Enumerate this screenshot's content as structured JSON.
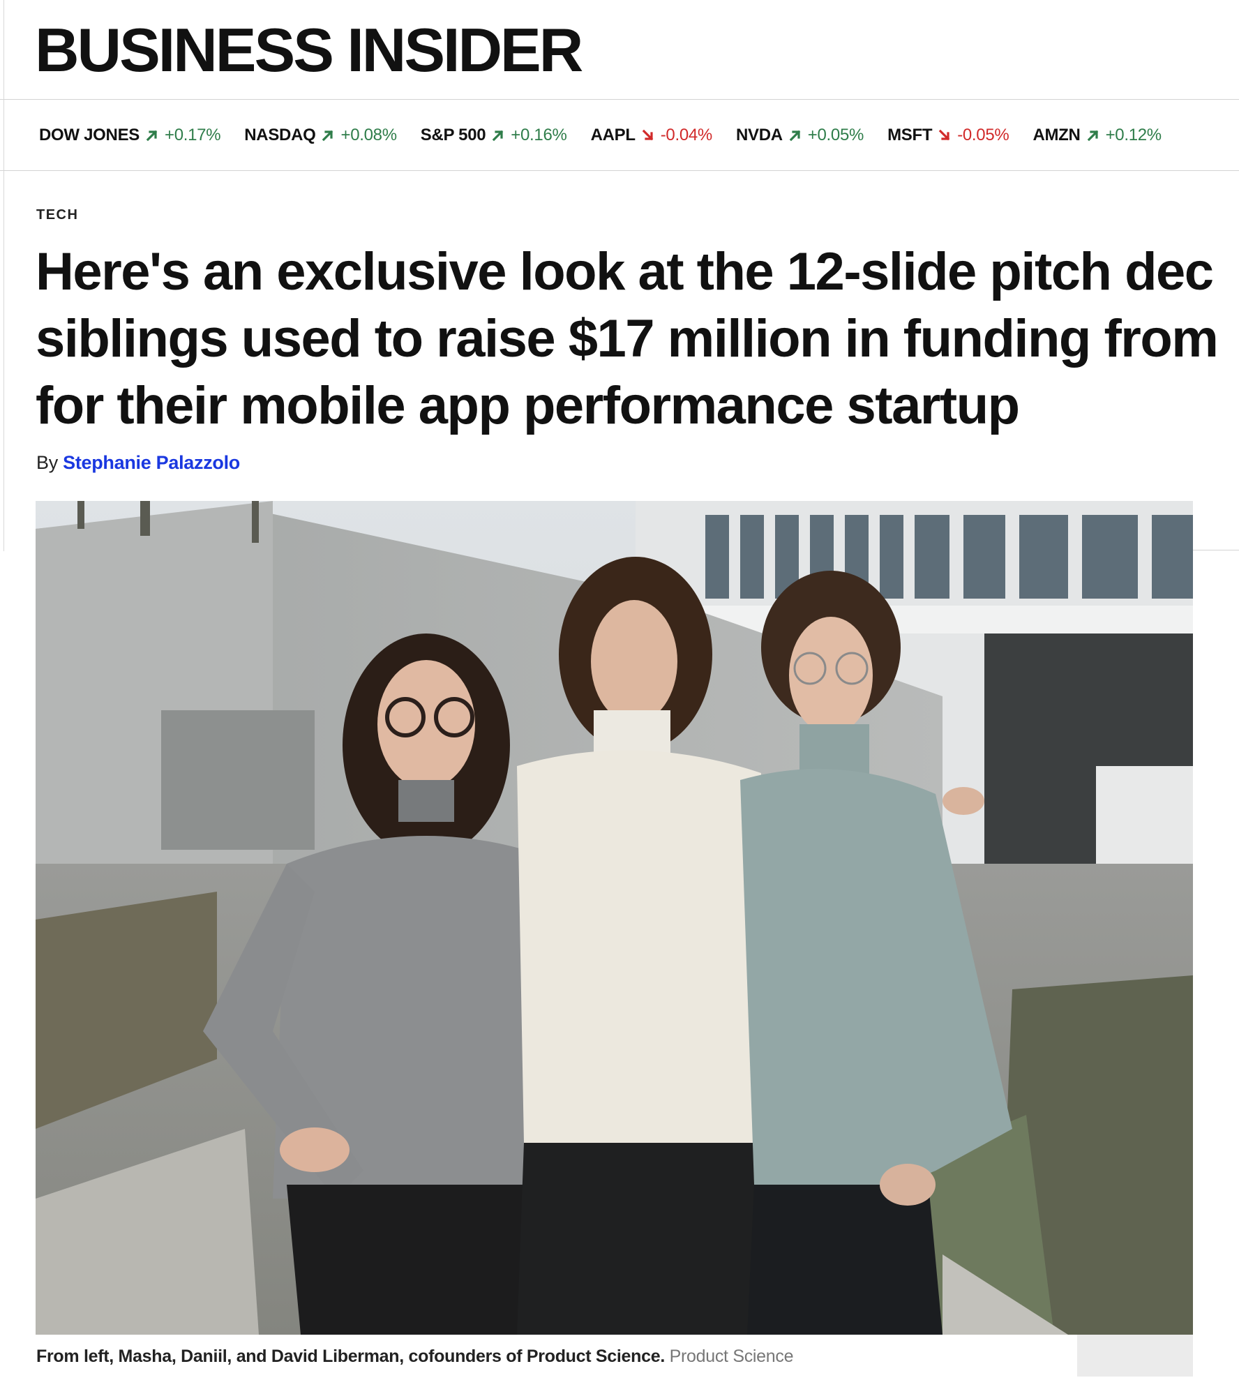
{
  "brand": {
    "logo_text": "BUSINESS INSIDER"
  },
  "ticker": [
    {
      "symbol": "DOW JONES",
      "direction": "up",
      "change": "+0.17%"
    },
    {
      "symbol": "NASDAQ",
      "direction": "up",
      "change": "+0.08%"
    },
    {
      "symbol": "S&P 500",
      "direction": "up",
      "change": "+0.16%"
    },
    {
      "symbol": "AAPL",
      "direction": "down",
      "change": "-0.04%"
    },
    {
      "symbol": "NVDA",
      "direction": "up",
      "change": "+0.05%"
    },
    {
      "symbol": "MSFT",
      "direction": "down",
      "change": "-0.05%"
    },
    {
      "symbol": "AMZN",
      "direction": "up",
      "change": "+0.12%"
    }
  ],
  "colors": {
    "up": "#2f7d4a",
    "down": "#d12a2a",
    "author_link": "#1a38e0"
  },
  "article": {
    "category": "TECH",
    "headline_lines": [
      "Here's an exclusive look at the 12-slide pitch dec",
      "siblings used to raise $17 million in funding from",
      "for their mobile app performance startup"
    ],
    "byline_prefix": "By",
    "author": "Stephanie Palazzolo",
    "image": {
      "caption": "From left, Masha, Daniil, and David Liberman, cofounders of Product Science.",
      "credit": "Product Science"
    }
  }
}
